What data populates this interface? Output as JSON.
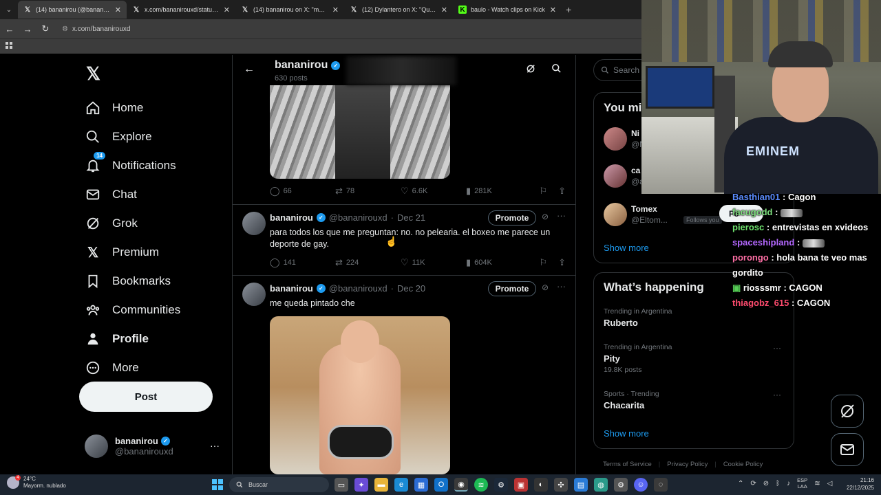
{
  "browser": {
    "tabs": [
      {
        "title": "(14) bananirou (@bananirouxd)",
        "favicon": "x-logo",
        "active": true
      },
      {
        "title": "x.com/bananirouxd/status/2003",
        "favicon": "x-logo",
        "active": false
      },
      {
        "title": "(14) bananirou on X: \"me qued",
        "favicon": "x-logo",
        "active": false
      },
      {
        "title": "(12) Dylantero on X: \"Que veng",
        "favicon": "x-logo",
        "active": false
      },
      {
        "title": "baulo - Watch clips on Kick",
        "favicon": "kick-logo",
        "active": false
      }
    ],
    "url": "x.com/bananirouxd"
  },
  "sidebar": {
    "items": [
      {
        "label": "Home",
        "icon": "home-icon"
      },
      {
        "label": "Explore",
        "icon": "search-icon"
      },
      {
        "label": "Notifications",
        "icon": "bell-icon",
        "badge": "14"
      },
      {
        "label": "Chat",
        "icon": "mail-icon"
      },
      {
        "label": "Grok",
        "icon": "grok-icon"
      },
      {
        "label": "Premium",
        "icon": "x-icon"
      },
      {
        "label": "Bookmarks",
        "icon": "bookmark-icon"
      },
      {
        "label": "Communities",
        "icon": "people-icon"
      },
      {
        "label": "Profile",
        "icon": "person-icon"
      },
      {
        "label": "More",
        "icon": "more-circle-icon"
      }
    ],
    "post_label": "Post",
    "account": {
      "name": "bananirou",
      "handle": "@bananirouxd"
    }
  },
  "header": {
    "name": "bananirou",
    "posts": "630 posts"
  },
  "first_actions": {
    "replies": "66",
    "reposts": "78",
    "likes": "6.6K",
    "views": "281K"
  },
  "tweets": [
    {
      "name": "bananirou",
      "handle": "@bananirouxd",
      "date": "Dec 21",
      "text": "para todos los que me preguntan: no. no pelearia. el boxeo me parece un deporte de gay.",
      "promote": "Promote",
      "replies": "141",
      "reposts": "224",
      "likes": "11K",
      "views": "604K"
    },
    {
      "name": "bananirou",
      "handle": "@bananirouxd",
      "date": "Dec 20",
      "text": "me queda pintado che",
      "promote": "Promote"
    }
  ],
  "right": {
    "search_placeholder": "Search",
    "wtf_title": "You mi",
    "wtf": [
      {
        "name": "Ni",
        "handle": "@N"
      },
      {
        "name": "ca",
        "handle": "@a"
      },
      {
        "name": "Tomex",
        "handle": "@Eltom...",
        "follows_you": "Follows you"
      }
    ],
    "show_more": "Show more",
    "happening_title": "What’s happening",
    "trends": [
      {
        "context": "Trending in Argentina",
        "name": "Ruberto",
        "count": ""
      },
      {
        "context": "Trending in Argentina",
        "name": "Pity",
        "count": "19.8K posts"
      },
      {
        "context": "Sports · Trending",
        "name": "Chacarita",
        "count": ""
      }
    ],
    "show_more_2": "Show more",
    "footer": [
      "Terms of Service",
      "Privacy Policy",
      "Cookie Policy"
    ],
    "follow_label": "Fo"
  },
  "chat": [
    {
      "user": "Basthian01",
      "color": "#5b8cff",
      "text": ": Cagon"
    },
    {
      "user": "facugodd",
      "color": "#7fe07f",
      "text": ":",
      "chip": true
    },
    {
      "user": "pierosc",
      "color": "#6ee36e",
      "text": ": entrevistas en xvideos"
    },
    {
      "user": "spaceshipland",
      "color": "#b468ff",
      "text": ":",
      "chip": true
    },
    {
      "user": "porongo",
      "color": "#ff6fa5",
      "text": ": hola bana te veo mas gordito"
    },
    {
      "user": "riosssmr",
      "color": "#ffffff",
      "text": ": CAGON"
    },
    {
      "user": "thiagobz_615",
      "color": "#ff4b6e",
      "text": ": CAGON"
    }
  ],
  "cam": {
    "shirt_text": "EMINEM"
  },
  "taskbar": {
    "temp": "24°C",
    "weather": "Mayorm. nublado",
    "weather_badge": "4",
    "search": "Buscar",
    "lang_top": "ESP",
    "lang_bottom": "LAA",
    "time": "21:16",
    "date": "22/12/2025"
  }
}
